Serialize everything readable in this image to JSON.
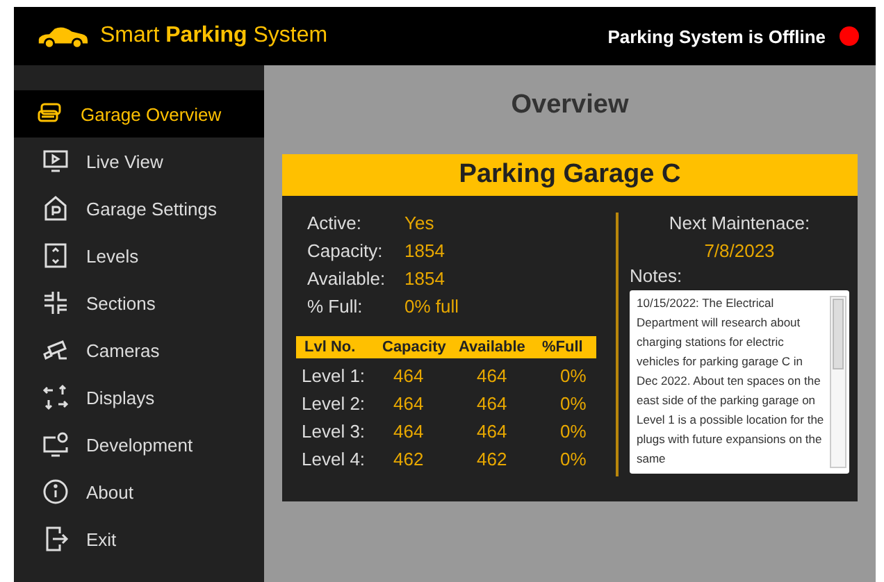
{
  "header": {
    "title": "Smart **Parking** System",
    "status": "Parking System is Offline"
  },
  "sidebar": {
    "items": [
      {
        "label": "Garage Overview",
        "kind": "garage",
        "selected": true
      },
      {
        "label": "Live View",
        "kind": "live",
        "selected": false
      },
      {
        "label": "Garage Settings",
        "kind": "settings",
        "selected": false
      },
      {
        "label": "Levels",
        "kind": "levels",
        "selected": false
      },
      {
        "label": "Sections",
        "kind": "sections",
        "selected": false
      },
      {
        "label": "Cameras",
        "kind": "camera",
        "selected": false
      },
      {
        "label": "Displays",
        "kind": "displays",
        "selected": false
      },
      {
        "label": "Development",
        "kind": "dev",
        "selected": false
      },
      {
        "label": "About",
        "kind": "about",
        "selected": false
      },
      {
        "label": "Exit",
        "kind": "exit",
        "selected": false
      }
    ]
  },
  "main": {
    "heading": "Overview",
    "card": {
      "title": "Parking Garage C",
      "stats": [
        {
          "label": "Active:",
          "value": "Yes"
        },
        {
          "label": "Capacity:",
          "value": "1854"
        },
        {
          "label": "Available:",
          "value": "1854"
        },
        {
          "label": "% Full:",
          "value": "0% full"
        }
      ],
      "table": {
        "columns": [
          "Lvl No.",
          "Capacity",
          "Available",
          "%Full"
        ],
        "rows": [
          [
            "Level 1:",
            "464",
            "464",
            "0%"
          ],
          [
            "Level 2:",
            "464",
            "464",
            "0%"
          ],
          [
            "Level 3:",
            "464",
            "464",
            "0%"
          ],
          [
            "Level 4:",
            "462",
            "462",
            "0%"
          ]
        ]
      },
      "maintenance_label": "Next Maintenace:",
      "maintenance_date": "7/8/2023",
      "notes_label": "Notes:",
      "notes": "10/15/2022: The Electrical Department will research about charging stations for electric vehicles for parking garage C in Dec 2022. About ten spaces on the east side of the parking garage on Level 1 is a possible location for the plugs with future expansions on the same"
    }
  }
}
